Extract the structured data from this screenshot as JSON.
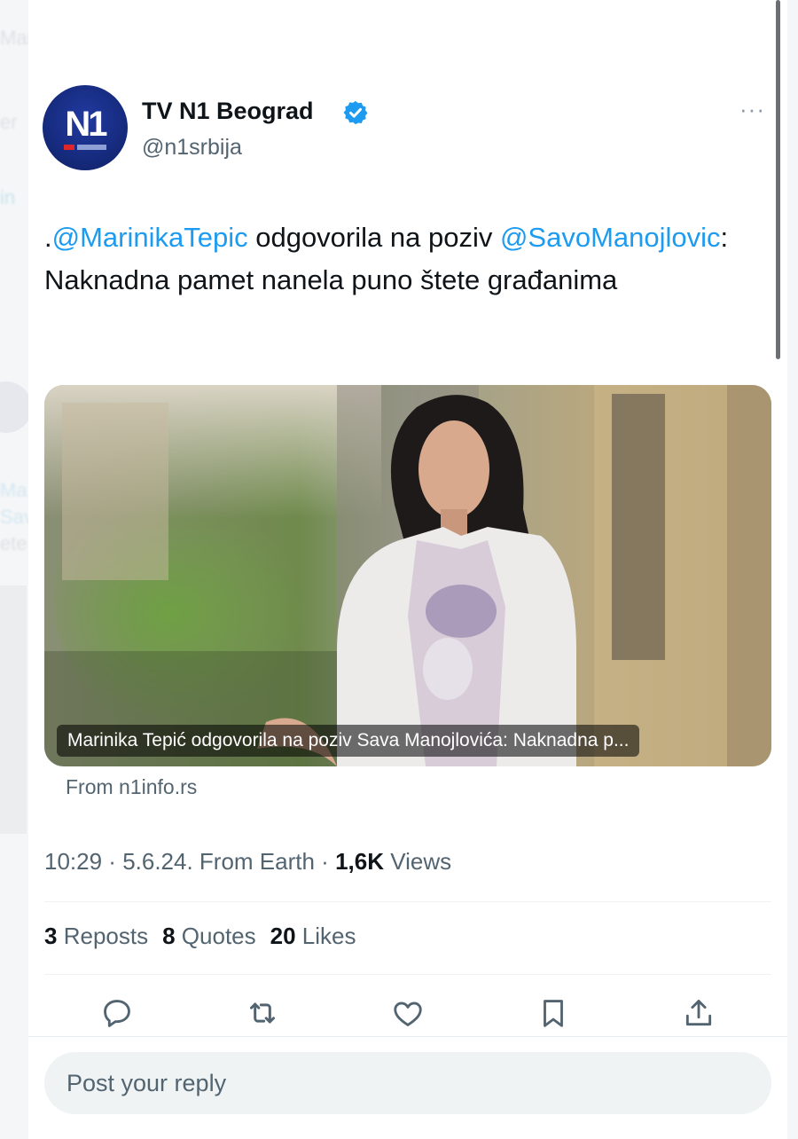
{
  "author": {
    "name": "TV N1 Beograd",
    "handle": "@n1srbija",
    "avatar_text": "N1",
    "verified": true
  },
  "tweet": {
    "prefix": ".",
    "mention1": "@MarinikaTepic",
    "text1": " odgovorila na poziv ",
    "mention2": "@SavoManojlovic",
    "text2": ": Naknadna pamet nanela puno štete građanima"
  },
  "media": {
    "caption": "Marinika Tepić odgovorila na poziv Sava Manojlovića: Naknadna p...",
    "source": "From n1info.rs"
  },
  "meta": {
    "time": "10:29",
    "sep1": " · ",
    "date": "5.6.24.",
    "source": " From Earth",
    "sep2": " · ",
    "views_count": "1,6K",
    "views_label": " Views"
  },
  "stats": {
    "reposts_count": "3",
    "reposts_label": "Reposts",
    "quotes_count": "8",
    "quotes_label": "Quotes",
    "likes_count": "20",
    "likes_label": "Likes"
  },
  "reply": {
    "placeholder": "Post your reply"
  },
  "colors": {
    "link": "#1d9bf0",
    "verified": "#1d9bf0",
    "secondary_text": "#536471",
    "primary_text": "#0f1419",
    "avatar_bg": "#162b7e"
  },
  "icons": [
    "more-icon",
    "verified-badge-icon",
    "reply-icon",
    "repost-icon",
    "like-icon",
    "bookmark-icon",
    "share-icon"
  ]
}
